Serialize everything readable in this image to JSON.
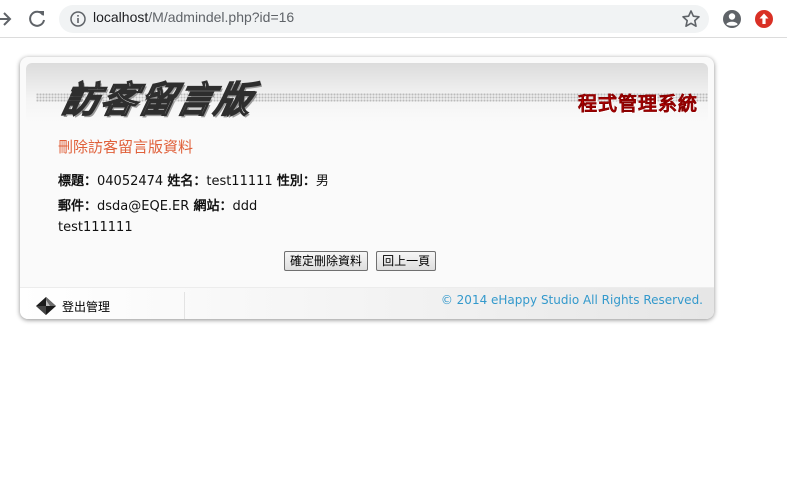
{
  "browser": {
    "url_host": "localhost",
    "url_path": "/M/admindel.php?id=16"
  },
  "header": {
    "title": "訪客留言版",
    "subtitle": "程式管理系統"
  },
  "main": {
    "section_title": "刪除訪客留言版資料",
    "fields": {
      "subject_label": "標題：",
      "subject_value": "04052474",
      "name_label": "姓名：",
      "name_value": "test11111",
      "gender_label": "性別：",
      "gender_value": "男",
      "email_label": "郵件：",
      "email_value": "dsda@EQE.ER",
      "website_label": "網站：",
      "website_value": "ddd",
      "content_value": "test111111"
    },
    "confirm_delete_label": "確定刪除資料",
    "back_label": "回上一頁"
  },
  "footer": {
    "logout_label": "登出管理",
    "copyright": "© 2014 eHappy Studio All Rights Reserved."
  },
  "colors": {
    "section_title": "#e0603a",
    "system_title": "#d40000",
    "copyright": "#3399cc",
    "update_icon": "#d93025"
  },
  "icons": [
    "back-arrow-icon",
    "reload-icon",
    "info-icon",
    "star-icon",
    "account-icon",
    "update-icon",
    "diamond-icon"
  ]
}
